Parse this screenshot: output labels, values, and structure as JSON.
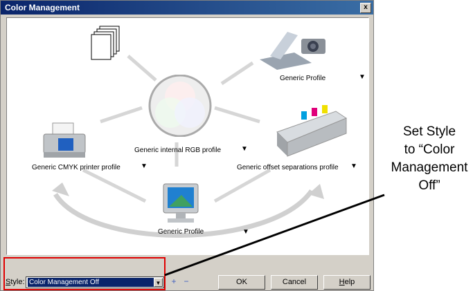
{
  "dialog": {
    "title": "Color Management",
    "close_glyph": "x"
  },
  "diagram": {
    "top_right_device_label": "Generic Profile",
    "center_label": "Generic internal RGB profile",
    "left_label": "Generic CMYK printer profile",
    "right_label": "Generic offset separations profile",
    "bottom_label": "Generic Profile",
    "dropdown_glyph": "▼"
  },
  "footer": {
    "style_label_prefix": "S",
    "style_label_rest": "tyle:",
    "style_value": "Color Management Off",
    "add_glyph": "+",
    "remove_glyph": "−",
    "ok_label": "OK",
    "cancel_label": "Cancel",
    "help_prefix": "H",
    "help_rest": "elp"
  },
  "annotation": {
    "text": "Set Style\nto “Color\nManagement\nOff”"
  },
  "colors": {
    "titlebar": "#0a246a",
    "selection": "#0a246a",
    "highlight": "#e00000"
  }
}
